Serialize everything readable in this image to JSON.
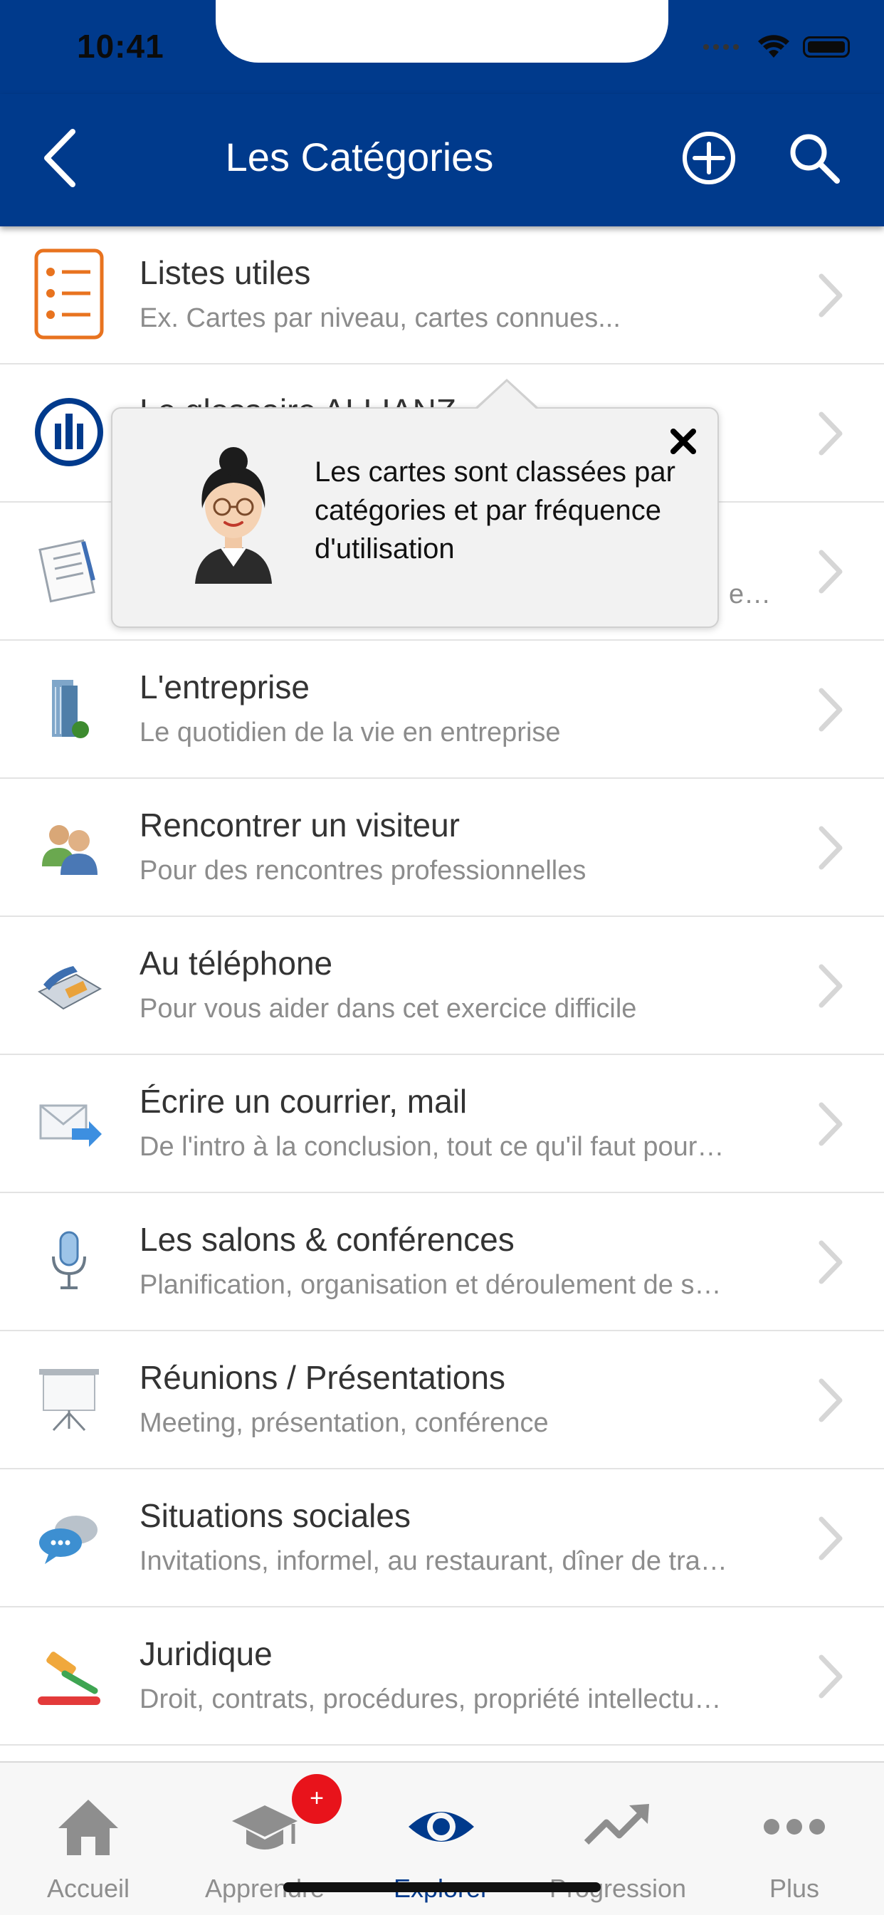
{
  "status_bar": {
    "time": "10:41"
  },
  "header": {
    "title": "Les Catégories",
    "back_icon": "chevron-left-icon",
    "add_icon": "plus-circle-icon",
    "search_icon": "search-icon",
    "bg_color": "#003a8c"
  },
  "list": {
    "items": [
      {
        "title": "Listes utiles",
        "subtitle": "Ex. Cartes par niveau, cartes connues...",
        "icon": "list-icon"
      },
      {
        "title": "Le glossaire ALLIANZ",
        "subtitle": "",
        "icon": "allianz-logo-icon"
      },
      {
        "title": "",
        "subtitle": "e…",
        "icon": "notepad-icon"
      },
      {
        "title": "L'entreprise",
        "subtitle": "Le quotidien de la vie en entreprise",
        "icon": "building-icon"
      },
      {
        "title": "Rencontrer un visiteur",
        "subtitle": "Pour des rencontres professionnelles",
        "icon": "people-icon"
      },
      {
        "title": "Au téléphone",
        "subtitle": "Pour vous aider dans cet exercice difficile",
        "icon": "telephone-icon"
      },
      {
        "title": "Écrire un courrier, mail",
        "subtitle": "De l'intro à la conclusion, tout ce qu'il faut pour…",
        "icon": "mail-icon"
      },
      {
        "title": "Les salons & conférences",
        "subtitle": "Planification, organisation et déroulement de s…",
        "icon": "microphone-icon"
      },
      {
        "title": "Réunions / Présentations",
        "subtitle": "Meeting, présentation, conférence",
        "icon": "presentation-board-icon"
      },
      {
        "title": "Situations sociales",
        "subtitle": "Invitations, informel, au restaurant, dîner de tra…",
        "icon": "chat-bubbles-icon"
      },
      {
        "title": "Juridique",
        "subtitle": "Droit, contrats, procédures, propriété intellectu…",
        "icon": "gavel-icon"
      }
    ]
  },
  "tooltip": {
    "message": "Les cartes sont classées par catégories et par fréquence d'utilisation",
    "close_icon": "close-icon",
    "avatar_icon": "assistant-avatar-icon"
  },
  "tabbar": {
    "tabs": [
      {
        "label": "Accueil",
        "icon": "home-icon",
        "active": false
      },
      {
        "label": "Apprendre",
        "icon": "graduation-cap-icon",
        "active": false,
        "badge": "+"
      },
      {
        "label": "Explorer",
        "icon": "eye-icon",
        "active": true
      },
      {
        "label": "Progression",
        "icon": "trend-up-icon",
        "active": false
      },
      {
        "label": "Plus",
        "icon": "more-dots-icon",
        "active": false
      }
    ],
    "active_color": "#003a8c"
  }
}
